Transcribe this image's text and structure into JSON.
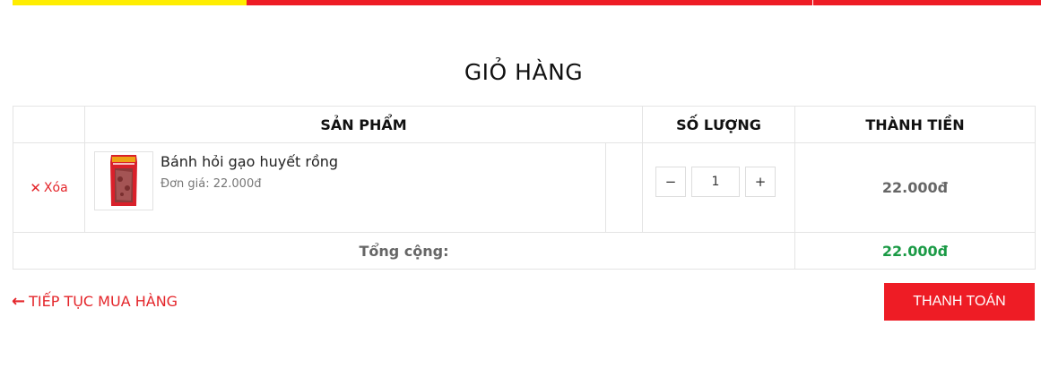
{
  "page_title": "GIỎ HÀNG",
  "colors": {
    "accent": "#ee1c25",
    "yellow": "#ffed00",
    "total_green": "#1a9a45"
  },
  "table": {
    "headers": {
      "product": "SẢN PHẨM",
      "quantity": "SỐ LƯỢNG",
      "subtotal": "THÀNH TIỀN"
    },
    "items": [
      {
        "remove_icon": "close-icon",
        "remove_label": "Xóa",
        "name": "Bánh hỏi gạo huyết rồng",
        "unit_price": "Đơn giá: 22.000đ",
        "quantity": "1",
        "minus_label": "−",
        "plus_label": "+",
        "line_total": "22.000đ"
      }
    ],
    "total_label": "Tổng cộng:",
    "total_value": "22.000đ"
  },
  "actions": {
    "continue_icon": "arrow-left-icon",
    "continue_label": "TIẾP TỤC MUA HÀNG",
    "checkout_label": "THANH TOÁN"
  }
}
